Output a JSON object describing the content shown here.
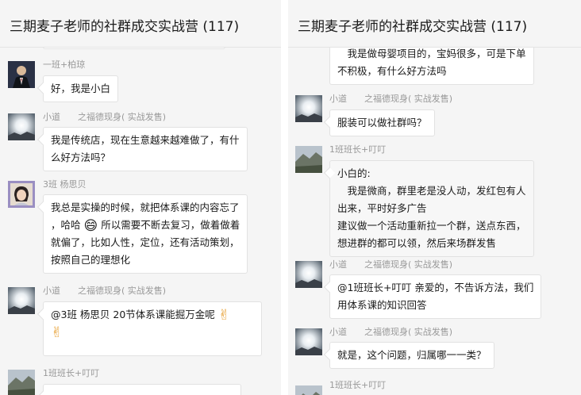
{
  "panels": [
    {
      "title": "三期麦子老师的社群成交实战营 (117)",
      "messages": [
        {
          "sender": "一班+柏琼",
          "avatar": "business-man",
          "lines": [
            "好，我是小白"
          ]
        },
        {
          "sender": "小道　　之福德现身( 实战发售)",
          "avatar": "sun",
          "lines": [
            "我是传统店，现在生意越来越难做了，有什",
            "么好方法吗？"
          ]
        },
        {
          "sender": "3班 杨思贝",
          "avatar": "woman",
          "lines": [
            "我总是实操的时候，就把体系课的内容忘了",
            "，哈哈",
            " 所以需要不断去复习，做着做着",
            "就偏了，比如人性，定位，还有活动策划，",
            "按照自己的理想化"
          ]
        },
        {
          "sender": "小道　　之福德现身( 实战发售)",
          "avatar": "sun",
          "lines": [
            "@3班 杨思贝 20节体系课能掘万金呢"
          ]
        },
        {
          "sender": "1班班长+叮叮",
          "avatar": "mountain",
          "lines": []
        }
      ]
    },
    {
      "title": "三期麦子老师的社群成交实战营 (117)",
      "messages": [
        {
          "sender": "",
          "avatar": "",
          "lines": [
            "　我是做母婴项目的，宝妈很多，可是下单",
            "不积极，有什么好方法吗"
          ]
        },
        {
          "sender": "小道　　之福德现身( 实战发售)",
          "avatar": "sun",
          "lines": [
            "服装可以做社群吗？"
          ]
        },
        {
          "sender": "1班班长+叮叮",
          "avatar": "mountain",
          "lines": [
            "小白的:",
            "　我是微商，群里老是没人动，发红包有人",
            "出来，平时好多广告",
            "建议做一个活动重新拉一个群，送点东西，",
            "想进群的都可以领，然后来场群发售"
          ]
        },
        {
          "sender": "小道　　之福德现身( 实战发售)",
          "avatar": "sun",
          "lines": [
            "@1班班长+叮叮 亲爱的，不告诉方法，我们",
            "用体系课的知识回答"
          ]
        },
        {
          "sender": "小道　　之福德现身( 实战发售)",
          "avatar": "sun",
          "lines": [
            "就是，这个问题，归属哪一一类？"
          ]
        },
        {
          "sender": "1班班长+叮叮",
          "avatar": "mountain",
          "lines": []
        }
      ]
    }
  ],
  "icons": {
    "laugh": "grinning-face-emoji",
    "victory": "victory-hand-emoji"
  },
  "colors": {
    "bg": "#f5f5f5",
    "bubble": "#ffffff",
    "sender": "#999999"
  }
}
